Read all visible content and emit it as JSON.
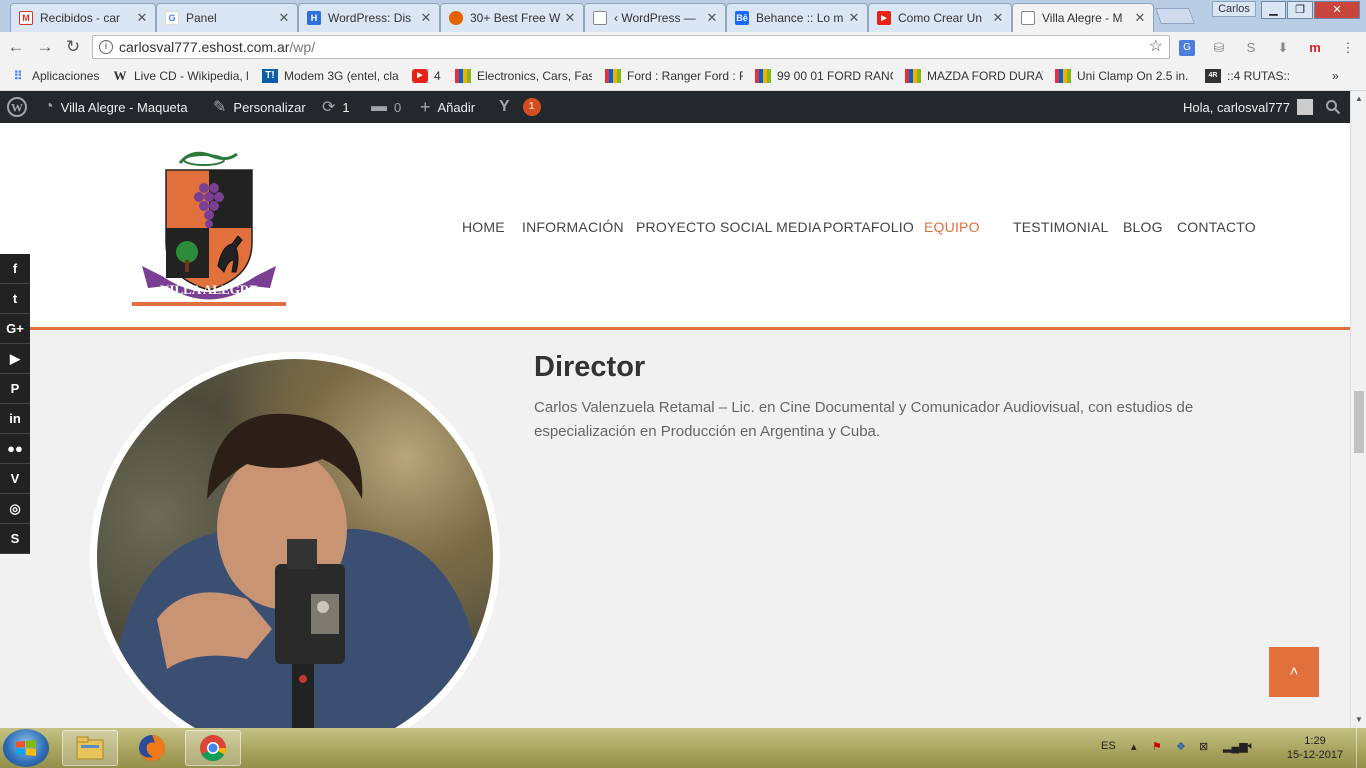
{
  "browser": {
    "tabs": [
      {
        "title": "Recibidos - car",
        "icon": "gmail-icon",
        "color": "#d93025"
      },
      {
        "title": "Panel",
        "icon": "google-icon",
        "color": "#4285f4"
      },
      {
        "title": "WordPress: Dis",
        "icon": "wordpress-h-icon",
        "color": "#2d6fdc"
      },
      {
        "title": "30+ Best Free W",
        "icon": "firefox-icon",
        "color": "#e66000"
      },
      {
        "title": "‹ WordPress —",
        "icon": "page-icon",
        "color": "#888888"
      },
      {
        "title": "Behance :: Lo m",
        "icon": "behance-icon",
        "color": "#1769ff"
      },
      {
        "title": "Como Crear Un",
        "icon": "youtube-icon",
        "color": "#e62117"
      },
      {
        "title": "Villa Alegre - M",
        "icon": "page-icon",
        "color": "#888888",
        "active": true
      }
    ],
    "window_user": "Carlos",
    "url_host": "carlosval777.eshost.com.ar",
    "url_path": "/wp/",
    "bookmarks": [
      {
        "label": "Aplicaciones",
        "icon": "apps-grid-icon"
      },
      {
        "label": "Live CD - Wikipedia, l",
        "icon": "wikipedia-icon"
      },
      {
        "label": "Modem 3G (entel, cla",
        "icon": "t-icon"
      },
      {
        "label": "4",
        "icon": "youtube-icon"
      },
      {
        "label": "Electronics, Cars, Fash",
        "icon": "ebay-icon"
      },
      {
        "label": "Ford : Ranger Ford : F",
        "icon": "ebay-icon"
      },
      {
        "label": "99 00 01 FORD RANG",
        "icon": "ebay-icon"
      },
      {
        "label": "MAZDA FORD DURAT",
        "icon": "ebay-icon"
      },
      {
        "label": "Uni Clamp On 2.5 in.",
        "icon": "ebay-icon"
      },
      {
        "label": "::4 RUTAS::",
        "icon": "rutas-icon"
      }
    ]
  },
  "wpbar": {
    "site_name": "Villa Alegre - Maqueta",
    "customize": "Personalizar",
    "updates": "1",
    "comments": "0",
    "add_new": "Añadir",
    "yoast_count": "1",
    "greeting": "Hola, carlosval777"
  },
  "site": {
    "logo_text": "VILLA ALEGRE",
    "nav": [
      "HOME",
      "INFORMACIÓN",
      "PROYECTO SOCIAL MEDIA",
      "PORTAFOLIO",
      "EQUIPO",
      "TESTIMONIAL",
      "BLOG",
      "CONTACTO"
    ],
    "active_nav": "EQUIPO",
    "accent": "#e1703d",
    "role": "Director",
    "bio": "Carlos Valenzuela Retamal – Lic. en Cine Documental y Comunicador Audiovisual, con estudios de especialización en Producción en Argentina y Cuba.",
    "social": [
      "f",
      "t",
      "G+",
      "▶",
      "P",
      "in",
      "●●",
      "V",
      "◎",
      "S"
    ],
    "to_top": "˄"
  },
  "taskbar": {
    "language": "ES",
    "time": "1:29",
    "date": "15-12-2017"
  }
}
